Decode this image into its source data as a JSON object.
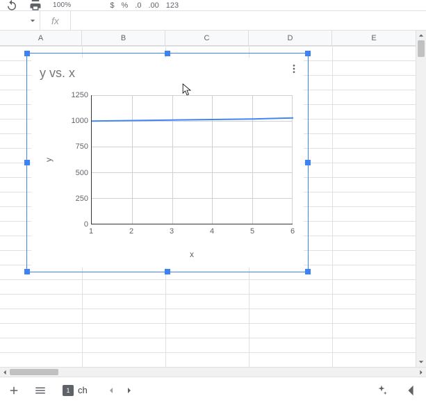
{
  "toolbar": {
    "zoom": "100%",
    "decimals": ".00",
    "decimal_adjust": "123"
  },
  "formula_bar": {
    "fx_label": "fx",
    "value": ""
  },
  "columns": [
    "A",
    "B",
    "C",
    "D",
    "E"
  ],
  "chart": {
    "title": "y vs. x",
    "xlabel": "x",
    "ylabel": "y"
  },
  "chart_data": {
    "type": "line",
    "x": [
      1,
      2,
      3,
      4,
      5,
      6
    ],
    "series": [
      {
        "name": "y",
        "values": [
          1000,
          1005,
          1010,
          1015,
          1020,
          1030
        ]
      }
    ],
    "title": "y vs. x",
    "xlabel": "x",
    "ylabel": "y",
    "xlim": [
      1,
      6
    ],
    "ylim": [
      0,
      1250
    ],
    "xticks": [
      1,
      2,
      3,
      4,
      5,
      6
    ],
    "yticks": [
      0,
      250,
      500,
      750,
      1000,
      1250
    ]
  },
  "sheetbar": {
    "comment_count": "1",
    "active_sheet_partial": "ch"
  }
}
